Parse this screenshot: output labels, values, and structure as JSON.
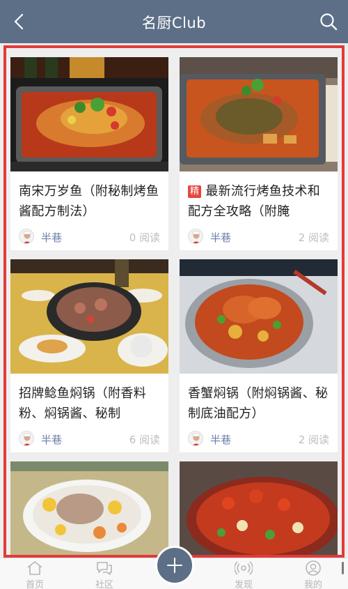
{
  "header": {
    "title": "名厨Club"
  },
  "cards": [
    {
      "title": "南宋万岁鱼（附秘制烤鱼酱配方制法）",
      "badge": "",
      "author": "半巷",
      "reads": "0 阅读"
    },
    {
      "title": "最新流行烤鱼技术和配方全攻略（附腌",
      "badge": "精",
      "author": "半巷",
      "reads": "2 阅读"
    },
    {
      "title": "招牌鲶鱼焖锅（附香料粉、焖锅酱、秘制",
      "badge": "",
      "author": "半巷",
      "reads": "6 阅读"
    },
    {
      "title": "香蟹焖锅（附焖锅酱、秘制底油配方）",
      "badge": "",
      "author": "半巷",
      "reads": "2 阅读"
    }
  ],
  "tabbar": {
    "home": "首页",
    "community": "社区",
    "discover": "发现",
    "mine": "我的"
  },
  "colors": {
    "header": "#5d6f87",
    "highlight": "#e23a3a",
    "author": "#6a7fa8",
    "badge": "#e5473f"
  }
}
